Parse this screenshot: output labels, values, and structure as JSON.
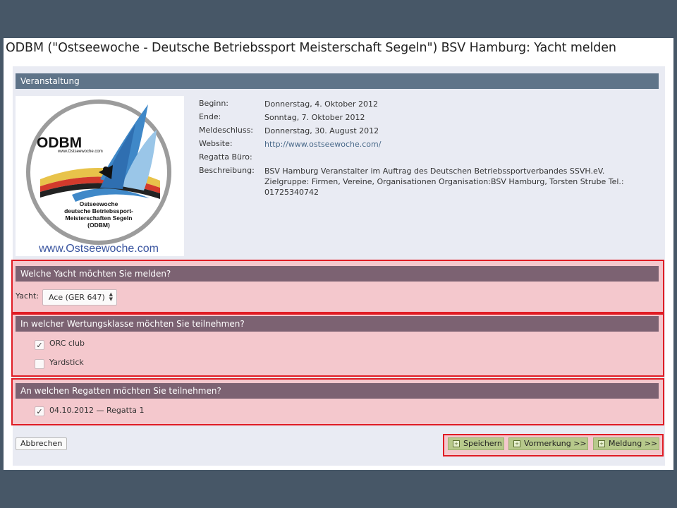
{
  "page": {
    "title": "ODBM (\"Ostseewoche - Deutsche Betriebssport Meisterschaft Segeln\") BSV Hamburg: Yacht melden"
  },
  "event": {
    "header": "Veranstaltung",
    "logo": {
      "acronym": "ODBM",
      "small_url": "www.Ostseewoche.com",
      "subtitle_lines": [
        "Ostseewoche",
        "deutsche Betriebssport-",
        "Meisterschaften Segeln",
        "(ODBM)"
      ],
      "footer_url": "www.Ostseewoche.com"
    },
    "fields": [
      {
        "label": "Beginn:",
        "value": "Donnerstag, 4. Oktober 2012"
      },
      {
        "label": "Ende:",
        "value": "Sonntag, 7. Oktober 2012"
      },
      {
        "label": "Meldeschluss:",
        "value": "Donnerstag, 30. August 2012"
      },
      {
        "label": "Website:",
        "value": "http://www.ostseewoche.com/"
      },
      {
        "label": "Regatta Büro:",
        "value": ""
      },
      {
        "label": "Beschreibung:",
        "value": "BSV Hamburg Veranstalter im Auftrag des Deutschen Betriebssportverbandes SSVH.eV. Zielgruppe: Firmen, Vereine, Organisationen Organisation:BSV Hamburg, Torsten Strube Tel.: 01725340742"
      }
    ]
  },
  "yacht_section": {
    "header": "Welche Yacht möchten Sie melden?",
    "label": "Yacht:",
    "selected": "Ace (GER 647)"
  },
  "class_section": {
    "header": "In welcher Wertungsklasse möchten Sie teilnehmen?",
    "options": [
      {
        "label": "ORC club",
        "checked": true
      },
      {
        "label": "Yardstick",
        "checked": false
      }
    ]
  },
  "regatta_section": {
    "header": "An welchen Regatten möchten Sie teilnehmen?",
    "options": [
      {
        "label": "04.10.2012 — Regatta 1",
        "checked": true
      }
    ]
  },
  "buttons": {
    "cancel": "Abbrechen",
    "save": "Speichern",
    "reserve": "Vormerkung >>",
    "submit": "Meldung >>"
  },
  "colors": {
    "background": "#475767",
    "header_blue": "#5f7489",
    "header_mauve": "#7c6272",
    "highlight_border": "#e01c24",
    "highlight_fill": "#f4c8cd",
    "button_green": "#b7c98b"
  }
}
